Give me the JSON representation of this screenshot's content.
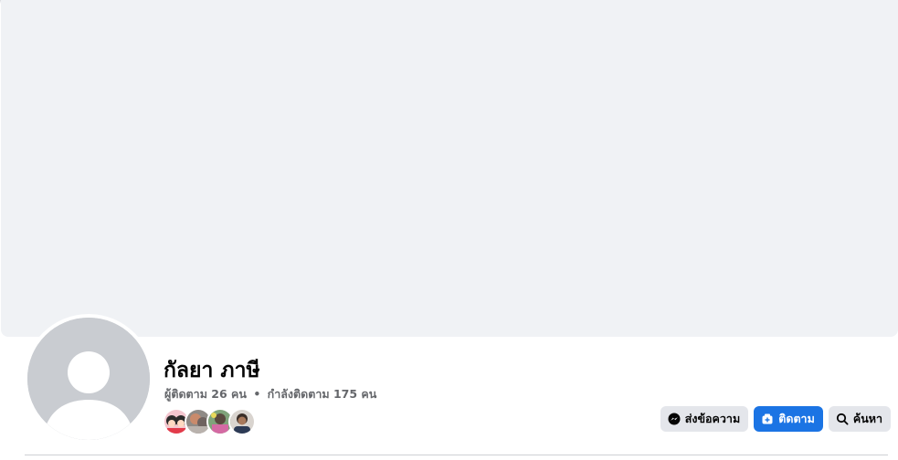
{
  "profile": {
    "name": "กัลยา ภาษี",
    "followers": "ผู้ติดตาม 26 คน",
    "separator": "•",
    "following": "กำลังติดตาม 175 คน"
  },
  "friends": [
    {
      "name": "friend-1",
      "icon": "avatar-couple"
    },
    {
      "name": "friend-2",
      "icon": "avatar-photo"
    },
    {
      "name": "friend-3",
      "icon": "avatar-photo"
    },
    {
      "name": "friend-4",
      "icon": "avatar-person"
    }
  ],
  "actions": {
    "message_label": "ส่งข้อความ",
    "follow_label": "ติดตาม",
    "search_label": "ค้นหา"
  },
  "colors": {
    "primary": "#1b74e4",
    "secondary_bg": "#e4e6eb",
    "cover_bg": "#f0f2f5",
    "muted_text": "#65676b"
  },
  "icons": {
    "message": "messenger-icon",
    "follow": "follow-icon",
    "search": "search-icon"
  }
}
